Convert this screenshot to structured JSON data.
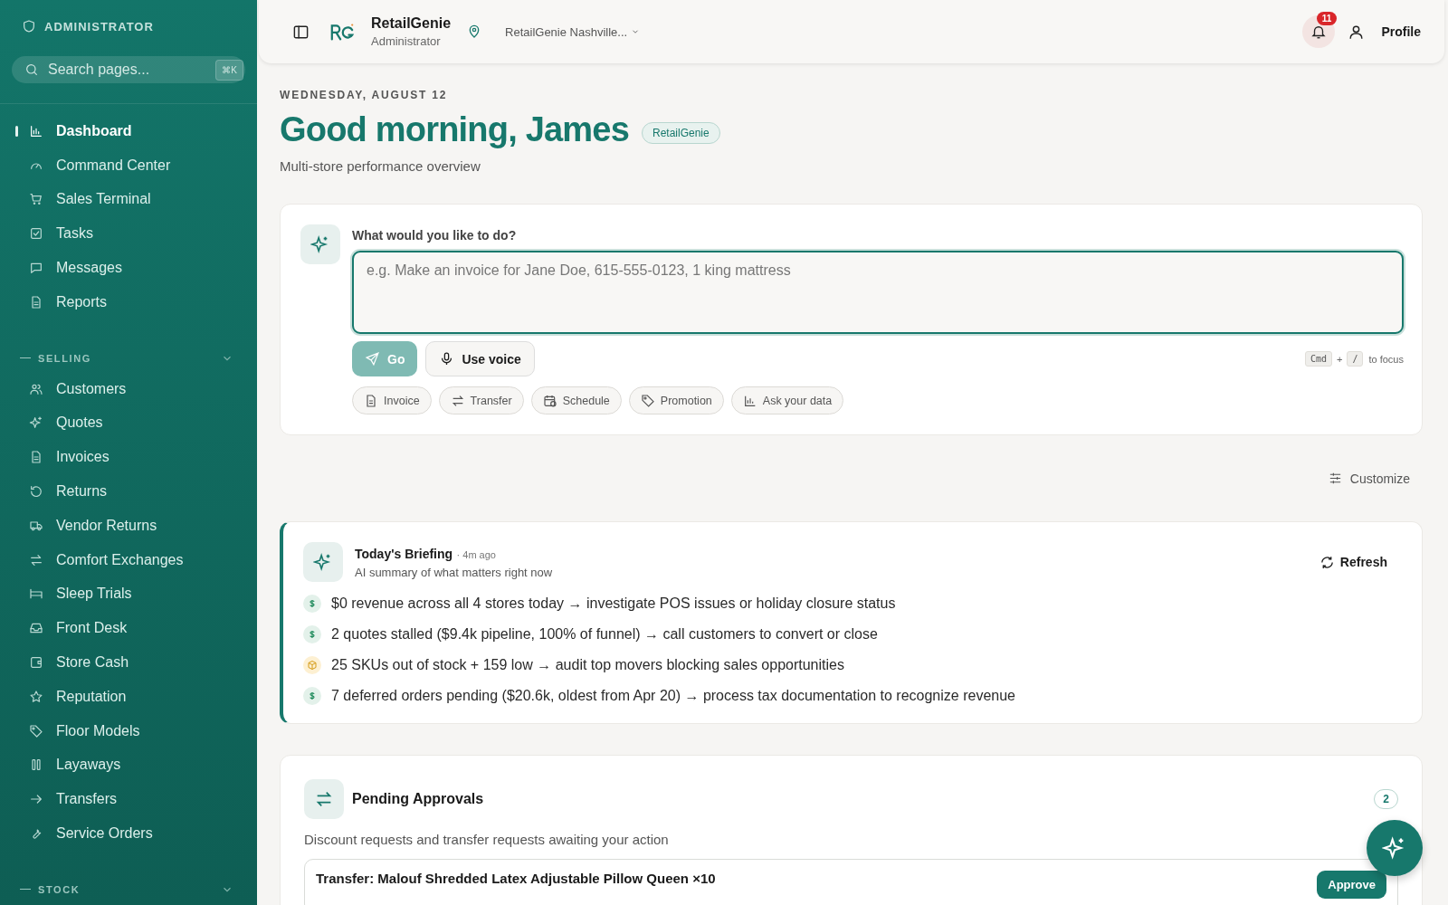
{
  "sidebar": {
    "role": "ADMINISTRATOR",
    "search": {
      "placeholder": "Search pages...",
      "shortcut": "⌘K"
    },
    "items": [
      {
        "label": "Dashboard",
        "selected": true
      },
      {
        "label": "Command Center",
        "selected": false
      },
      {
        "label": "Sales Terminal",
        "selected": false
      },
      {
        "label": "Tasks",
        "selected": false
      },
      {
        "label": "Messages",
        "selected": false
      },
      {
        "label": "Reports",
        "selected": false
      }
    ],
    "sections": [
      {
        "title": "SELLING",
        "items": [
          {
            "label": "Customers",
            "selected": false
          },
          {
            "label": "Quotes",
            "selected": false
          },
          {
            "label": "Invoices",
            "selected": false
          },
          {
            "label": "Returns",
            "selected": false
          },
          {
            "label": "Vendor Returns",
            "selected": false
          },
          {
            "label": "Comfort Exchanges",
            "selected": false
          },
          {
            "label": "Sleep Trials",
            "selected": false
          },
          {
            "label": "Front Desk",
            "selected": false
          },
          {
            "label": "Store Cash",
            "selected": false
          },
          {
            "label": "Reputation",
            "selected": false
          },
          {
            "label": "Floor Models",
            "selected": false
          },
          {
            "label": "Layaways",
            "selected": false
          },
          {
            "label": "Transfers",
            "selected": false
          },
          {
            "label": "Service Orders",
            "selected": false
          }
        ]
      },
      {
        "title": "STOCK"
      }
    ]
  },
  "header": {
    "brand": "RetailGenie",
    "role": "Administrator",
    "location": "RetailGenie Nashville...",
    "notifications": "11",
    "profile": "Profile"
  },
  "greeting": {
    "date": "WEDNESDAY, AUGUST 12",
    "title": "Good morning, James",
    "tag": "RetailGenie",
    "subtitle": "Multi-store performance overview"
  },
  "command": {
    "label": "What would you like to do?",
    "placeholder": "e.g. Make an invoice for Jane Doe, 615-555-0123, 1 king mattress",
    "go": "Go",
    "voice": "Use voice",
    "shortcut_keys": [
      "Cmd",
      "/"
    ],
    "shortcut_plus": "+",
    "shortcut_text": "to focus",
    "chips": [
      "Invoice",
      "Transfer",
      "Schedule",
      "Promotion",
      "Ask your data"
    ]
  },
  "customize": "Customize",
  "briefing": {
    "title": "Today's Briefing",
    "age": "· 4m ago",
    "subtitle": "AI summary of what matters right now",
    "refresh": "Refresh",
    "items": [
      {
        "kind": "revenue",
        "text": "$0 revenue across all 4 stores today → investigate POS issues or holiday closure status"
      },
      {
        "kind": "revenue",
        "text": "2 quotes stalled ($9.4k pipeline, 100% of funnel) → call customers to convert or close"
      },
      {
        "kind": "stock",
        "text": "25 SKUs out of stock + 159 low → audit top movers blocking sales opportunities"
      },
      {
        "kind": "revenue",
        "text": "7 deferred orders pending ($20.6k, oldest from Apr 20) → process tax documentation to recognize revenue"
      }
    ]
  },
  "approvals": {
    "title": "Pending Approvals",
    "count": "2",
    "subtitle": "Discount requests and transfer requests awaiting your action",
    "items": [
      {
        "title": "Transfer: Malouf Shredded Latex Adjustable Pillow Queen ×10",
        "action": "Approve"
      }
    ]
  }
}
